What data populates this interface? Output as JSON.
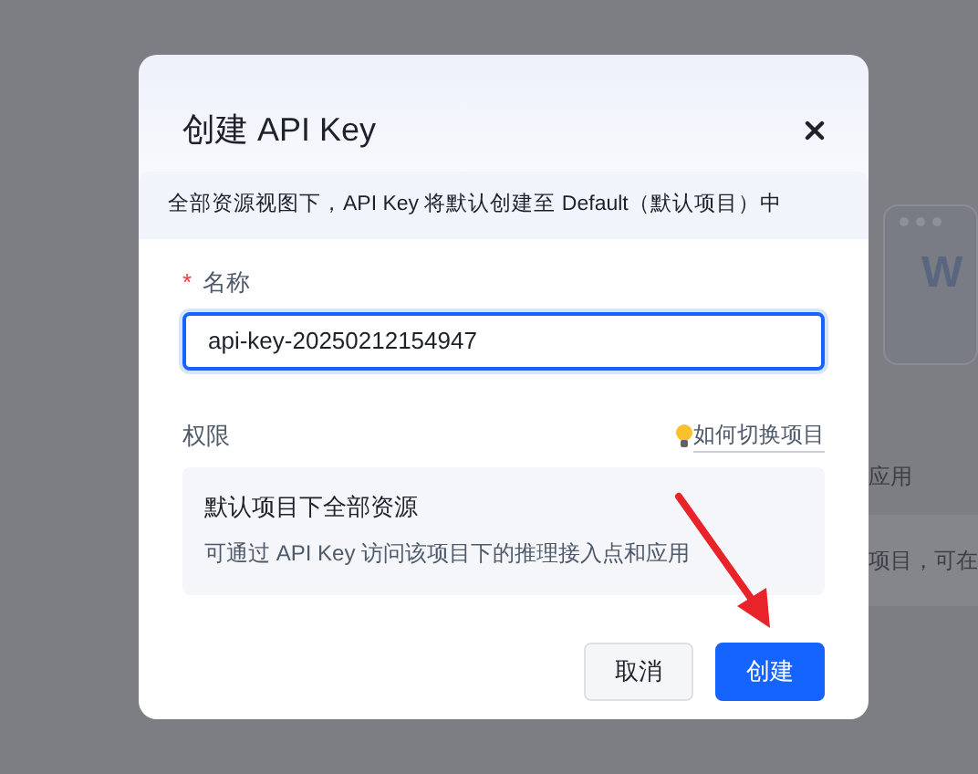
{
  "background": {
    "card_letter": "W",
    "texts": [
      "应用",
      "项目，可在"
    ]
  },
  "dialog": {
    "title": "创建 API Key",
    "notice": "全部资源视图下，API Key 将默认创建至 Default（默认项目）中",
    "name_field": {
      "required_mark": "*",
      "label": "名称",
      "value": "api-key-20250212154947",
      "focused": true
    },
    "permission": {
      "label": "权限",
      "help_link": "如何切换项目",
      "card_title": "默认项目下全部资源",
      "card_text": "可通过 API Key 访问该项目下的推理接入点和应用"
    },
    "buttons": [
      {
        "label": "取消",
        "kind": "secondary"
      },
      {
        "label": "创建",
        "kind": "primary"
      }
    ]
  }
}
